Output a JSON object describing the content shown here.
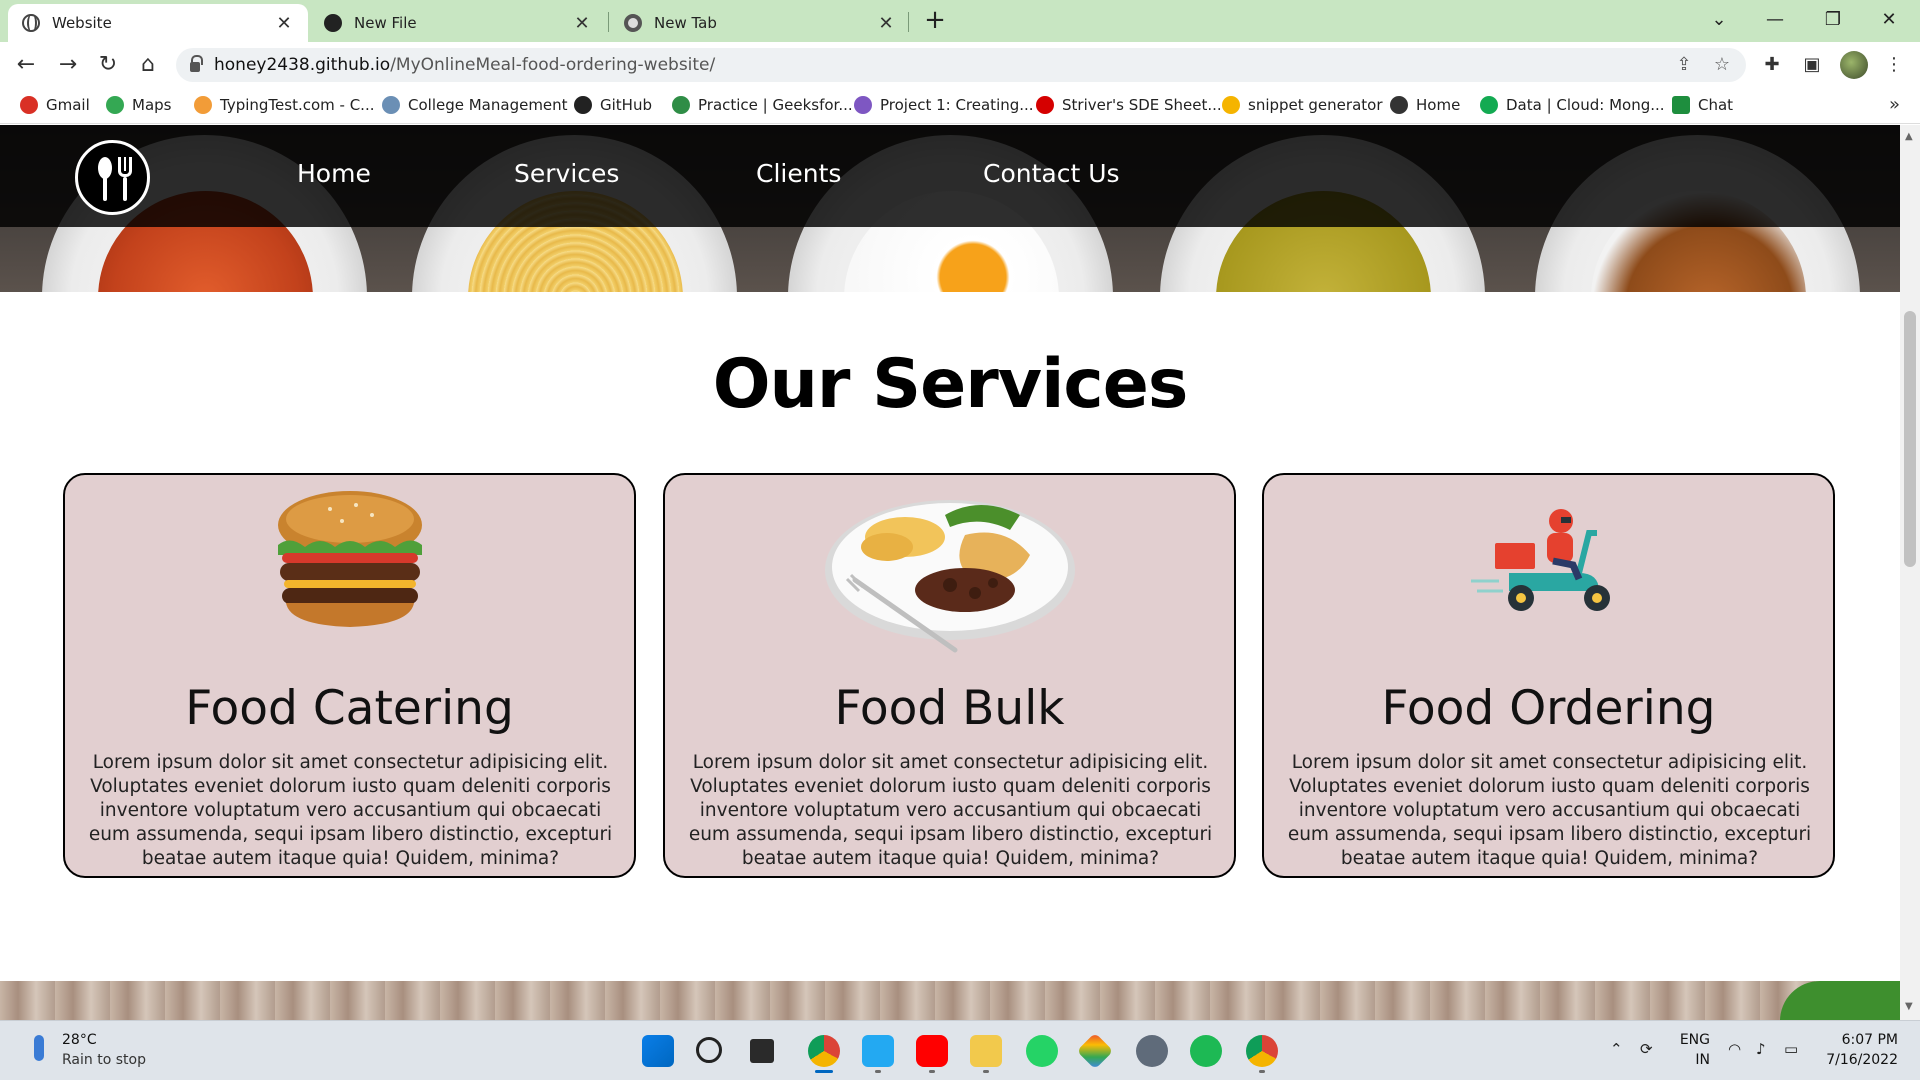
{
  "browser": {
    "tabs": [
      {
        "label": "Website",
        "active": true,
        "icon": "globe-icon"
      },
      {
        "label": "New File",
        "active": false,
        "icon": "github-icon"
      },
      {
        "label": "New Tab",
        "active": false,
        "icon": "chrome-icon"
      }
    ],
    "url": {
      "host": "honey2438.github.io",
      "path": "/MyOnlineMeal-food-ordering-website/"
    },
    "bookmarks": [
      {
        "label": "Gmail",
        "color": "#d93025"
      },
      {
        "label": "Maps",
        "color": "#34a853"
      },
      {
        "label": "TypingTest.com - C...",
        "color": "#f29c38"
      },
      {
        "label": "College Management",
        "color": "#6b8fb5"
      },
      {
        "label": "GitHub",
        "color": "#222222"
      },
      {
        "label": "Practice | Geeksfor...",
        "color": "#2f8d46"
      },
      {
        "label": "Project 1: Creating...",
        "color": "#7e57c2"
      },
      {
        "label": "Striver's SDE Sheet...",
        "color": "#d50000"
      },
      {
        "label": "snippet generator",
        "color": "#f5b400"
      },
      {
        "label": "Home",
        "color": "#333333"
      },
      {
        "label": "Data | Cloud: Mong...",
        "color": "#13aa52"
      },
      {
        "label": "Chat",
        "color": "#1e8e3e"
      }
    ]
  },
  "site": {
    "nav": {
      "links": [
        "Home",
        "Services",
        "Clients",
        "Contact Us"
      ]
    },
    "services": {
      "title": "Our Services",
      "cards": [
        {
          "title": "Food Catering",
          "text": "Lorem ipsum dolor sit amet consectetur adipisicing elit. Voluptates eveniet dolorum iusto quam deleniti corporis inventore voluptatum vero accusantium qui obcaecati eum assumenda, sequi ipsam libero distinctio, excepturi beatae autem itaque quia! Quidem, minima?",
          "image": "burger"
        },
        {
          "title": "Food Bulk",
          "text": "Lorem ipsum dolor sit amet consectetur adipisicing elit. Voluptates eveniet dolorum iusto quam deleniti corporis inventore voluptatum vero accusantium qui obcaecati eum assumenda, sequi ipsam libero distinctio, excepturi beatae autem itaque quia! Quidem, minima?",
          "image": "meal-plate"
        },
        {
          "title": "Food Ordering",
          "text": "Lorem ipsum dolor sit amet consectetur adipisicing elit. Voluptates eveniet dolorum iusto quam deleniti corporis inventore voluptatum vero accusantium qui obcaecati eum assumenda, sequi ipsam libero distinctio, excepturi beatae autem itaque quia! Quidem, minima?",
          "image": "delivery-scooter"
        }
      ],
      "card_background": "#e2cfd0"
    }
  },
  "taskbar": {
    "weather": {
      "temp": "28°C",
      "desc": "Rain to stop"
    },
    "apps": [
      "windows-start-icon",
      "search-icon",
      "task-view-icon",
      "chrome-icon",
      "vscode-icon",
      "youtube-icon",
      "file-explorer-icon",
      "whatsapp-icon",
      "git-icon",
      "settings-icon",
      "spotify-icon",
      "chrome-profile-icon"
    ],
    "language": {
      "line1": "ENG",
      "line2": "IN"
    },
    "clock": {
      "time": "6:07 PM",
      "date": "7/16/2022"
    }
  },
  "colors": {
    "tabbar": "#c8e6c2",
    "navbar": "#000000",
    "accent_taskbar": "#0067c0"
  }
}
